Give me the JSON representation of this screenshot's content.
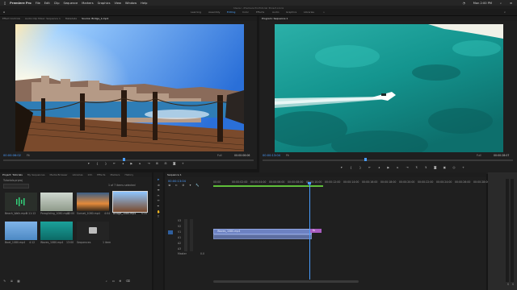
{
  "menubar": {
    "app": "Premiere Pro",
    "items": [
      "File",
      "Edit",
      "Clip",
      "Sequence",
      "Markers",
      "Graphics",
      "View",
      "Window",
      "Help"
    ],
    "clock": "Mon 2:00 PM"
  },
  "title": "/Users/…/Premiere Pro/Tutorial_Project.prproj",
  "workspaces": [
    "Learning",
    "Assembly",
    "Editing",
    "Color",
    "Effects",
    "Audio",
    "Graphics",
    "Libraries"
  ],
  "source_panel": {
    "tabs": [
      "Effect Controls",
      "Audio Clip Mixer: Sequence 1",
      "Metadata",
      "Source: Bridge_1.mp4"
    ],
    "timecode_in": "00:00:06:02",
    "fit": "Fit",
    "duration": "00:00:06:06",
    "ratio": "Full"
  },
  "program_panel": {
    "tab": "Program: Sequence 1",
    "timecode_in": "00:00:13:04",
    "fit": "Fit",
    "ratio": "Full",
    "duration": "00:00:28:07"
  },
  "project_panel": {
    "tabs": [
      "Project: Tutorials",
      "My Sequences",
      "Media Browser",
      "Libraries",
      "Info",
      "Effects",
      "Markers",
      "History"
    ],
    "project_file": "Tutorials.prproj",
    "item_count": "1 of 7 items selected",
    "items": [
      {
        "name": "Beach_Walk.mp4",
        "dur": "0:11:12"
      },
      {
        "name": "Paragliding_1080.mp4",
        "dur": "12:00"
      },
      {
        "name": "Sunset_1080.mp4",
        "dur": "4:04"
      },
      {
        "name": "Bridge_1080.mp4",
        "dur": "6:06"
      },
      {
        "name": "Boat_1080.mp4",
        "dur": "4:12"
      },
      {
        "name": "Waves_1080.mp4",
        "dur": "13:00"
      },
      {
        "name": "Sequences",
        "dur": "1 item"
      }
    ]
  },
  "timeline": {
    "tab": "Sequence 1",
    "timecode": "00:00:13:04",
    "ruler": [
      "00:00",
      "00:00:02:00",
      "00:00:04:00",
      "00:00:06:00",
      "00:00:08:00",
      "00:00:10:00",
      "00:00:12:00",
      "00:00:14:00",
      "00:00:16:00",
      "00:00:18:00",
      "00:00:20:00",
      "00:00:22:00",
      "00:00:24:00",
      "00:00:26:00",
      "00:00:28:00"
    ],
    "video_tracks": [
      "V3",
      "V2",
      "V1"
    ],
    "audio_tracks": [
      "A1",
      "A2",
      "A3"
    ],
    "master": "Master",
    "master_value": "0.0",
    "clip_video": "Waves_1080.mp4",
    "clip_label_purple": "fx"
  },
  "colors": {
    "accent_blue": "#4a9dff",
    "playhead": "#4a9dff",
    "clip_video": "#6d82c2",
    "clip_purple": "#a85cc0"
  }
}
